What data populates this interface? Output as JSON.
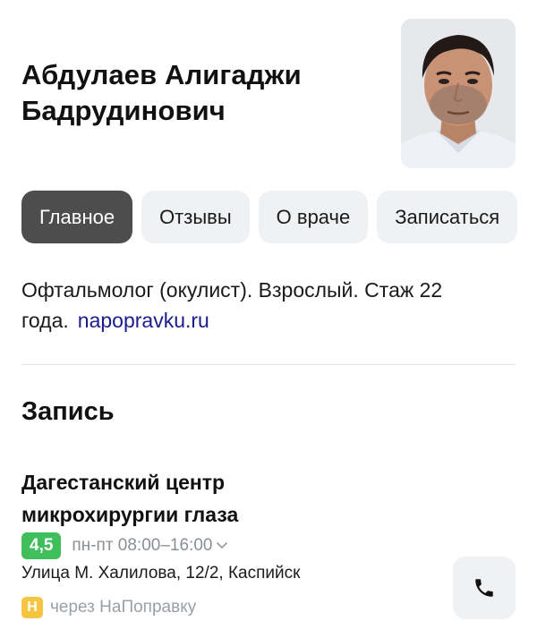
{
  "doctor": {
    "name_line1": "Абдулаев Алигаджи",
    "name_line2": "Бадрудинович",
    "description": "Офтальмолог (окулист). Взрослый. Стаж 22 года.",
    "source": "napopravku.ru"
  },
  "tabs": [
    {
      "label": "Главное",
      "active": true
    },
    {
      "label": "Отзывы",
      "active": false
    },
    {
      "label": "О враче",
      "active": false
    },
    {
      "label": "Записаться",
      "active": false
    }
  ],
  "booking": {
    "title": "Запись",
    "clinic": {
      "name_line1": "Дагестанский центр",
      "name_line2": "микрохирургии глаза",
      "rating": "4,5",
      "rating_color": "#3fbf5b",
      "hours": "пн-пт 08:00–16:00",
      "address": "Улица М. Халилова, 12/2, Каспийск",
      "provider_badge": "Н",
      "provider_badge_color": "#f5c542",
      "via": "через НаПоправку"
    }
  },
  "icons": {
    "call": "phone-icon",
    "hours_toggle": "chevron-down-icon"
  }
}
